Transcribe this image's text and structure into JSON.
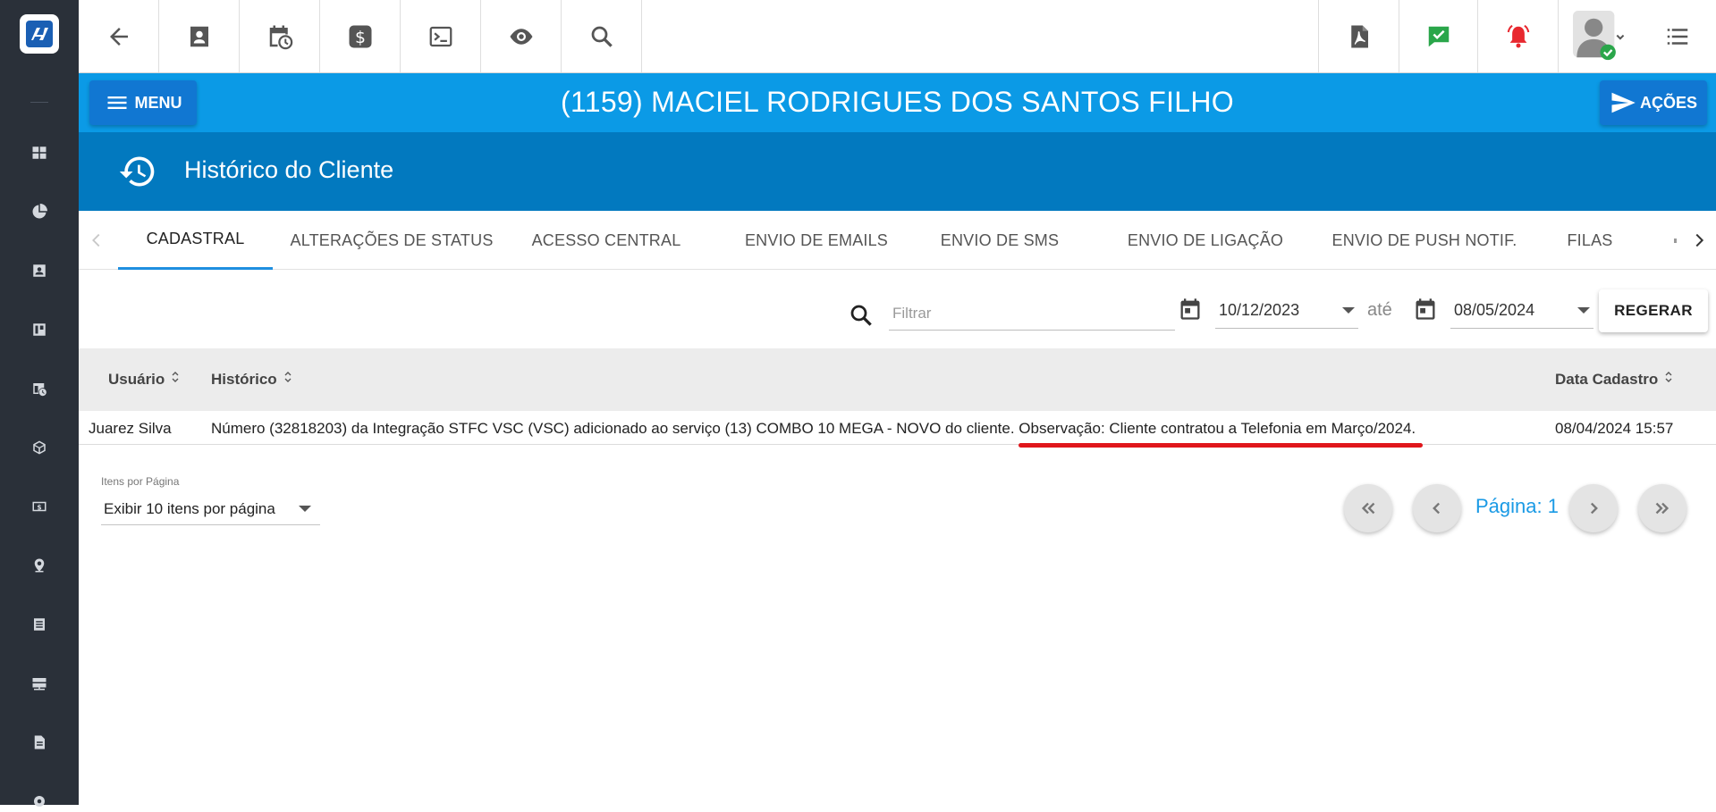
{
  "colors": {
    "sidebar_bg": "#2a3039",
    "title_band": "#0b9ae6",
    "section_band": "#0279bf",
    "button_blue": "#1177d2",
    "active_tab_underline": "#1f8fe0",
    "highlight_mark": "#e0161b",
    "pagination_text": "#1a9ae5"
  },
  "sidebar": {
    "logo": "company-logo",
    "items": [
      "dashboard-icon",
      "pie-chart-icon",
      "contact-card-icon",
      "kanban-icon",
      "calendar-clock-icon",
      "package-icon",
      "money-icon",
      "location-icon",
      "list-icon",
      "server-icon",
      "document-icon",
      "settings-icon"
    ]
  },
  "toolbar": {
    "left_icons": [
      "back-arrow-icon",
      "client-card-icon",
      "calendar-clock-icon",
      "dollar-icon",
      "terminal-icon",
      "eye-icon",
      "search-icon"
    ],
    "right_icons": [
      "pdf-icon",
      "check-message-icon",
      "alarm-bell-icon",
      "user-avatar",
      "menu-list-icon"
    ]
  },
  "header": {
    "menu_label": "MENU",
    "client_title": "(1159) MACIEL RODRIGUES DOS SANTOS FILHO",
    "actions_label": "AÇÕES"
  },
  "section": {
    "title": "Histórico do Cliente",
    "icon": "history-icon"
  },
  "tabs": [
    {
      "label": "CADASTRAL",
      "active": true
    },
    {
      "label": "ALTERAÇÕES DE STATUS"
    },
    {
      "label": "ACESSO CENTRAL"
    },
    {
      "label": "ENVIO DE EMAILS"
    },
    {
      "label": "ENVIO DE SMS"
    },
    {
      "label": "ENVIO DE LIGAÇÃO"
    },
    {
      "label": "ENVIO DE PUSH NOTIF."
    },
    {
      "label": "FILAS"
    }
  ],
  "filters": {
    "search_placeholder": "Filtrar",
    "date_from": "10/12/2023",
    "between_label": "até",
    "date_to": "08/05/2024",
    "regenerate_label": "REGERAR"
  },
  "table": {
    "columns": {
      "user": "Usuário",
      "history": "Histórico",
      "date": "Data Cadastro"
    },
    "rows": [
      {
        "user": "Juarez Silva",
        "history_main": "Número (32818203) da Integração STFC VSC (VSC) adicionado ao serviço (13) COMBO 10 MEGA - NOVO do cliente.",
        "history_note": "Observação: Cliente contratou a Telefonia em Março/2024.",
        "date": "08/04/2024 15:57"
      }
    ]
  },
  "pagination": {
    "items_per_page_label": "Itens por Página",
    "items_per_page_value": "Exibir 10 itens por página",
    "page_label": "Página: 1"
  }
}
